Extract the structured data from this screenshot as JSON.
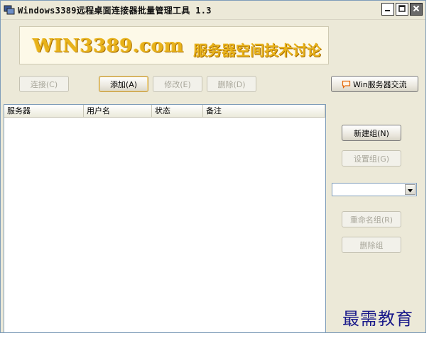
{
  "window": {
    "title": "Windows3389远程桌面连接器批量管理工具 1.3"
  },
  "banner": {
    "site": "WIN3389.com",
    "slogan": "服务器空间技术讨论"
  },
  "toolbar": {
    "connect": "连接(C)",
    "add": "添加(A)",
    "modify": "修改(E)",
    "delete": "删除(D)",
    "exchange": "Win服务器交流"
  },
  "list": {
    "columns": [
      "服务器",
      "用户名",
      "状态",
      "备注"
    ],
    "rows": []
  },
  "groups": {
    "new_group": "新建组(N)",
    "set_group": "设置组(G)",
    "selected_group": "",
    "rename_group": "重命名组(R)",
    "delete_group": "删除组"
  },
  "watermark": "最需教育",
  "icons": {
    "app": "remote-desktop-icon",
    "exchange": "chat-bubble-icon",
    "minimize": "minimize-icon",
    "maximize": "maximize-icon",
    "close": "close-icon",
    "dropdown": "chevron-down-icon"
  },
  "colors": {
    "window_bg": "#ece9d8",
    "banner_text": "#e8b21a",
    "watermark": "#1a1a8a",
    "chat_icon": "#e46a0c"
  }
}
